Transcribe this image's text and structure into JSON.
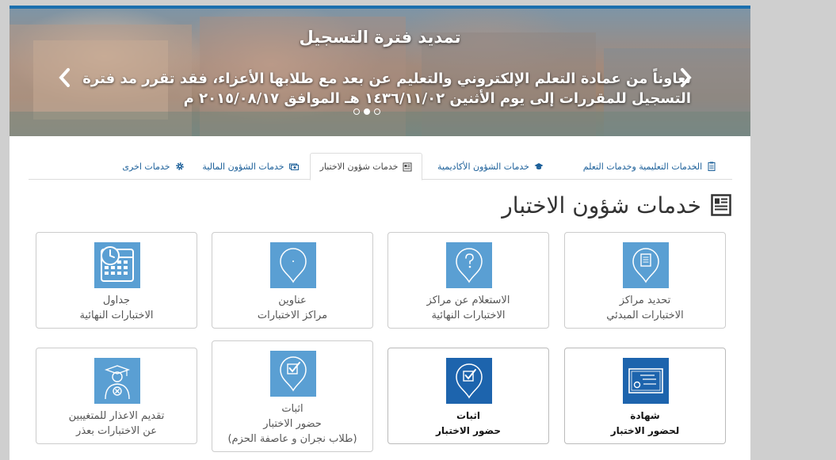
{
  "slider": {
    "title": "تمديد فترة التسجيل",
    "text": "تعاوناً من عمادة التعلم الإلكتروني والتعليم عن بعد مع طلابها الأعزاء، فقد تقرر مد فترة التسجيل للمقررات إلى يوم الأثنين ١٤٣٦/١١/٠٢ هـ الموافق ٢٠١٥/٠٨/١٧ م",
    "active_dot": 2
  },
  "tabs": [
    {
      "label": "الخدمات التعليمية وخدمات التعلم",
      "icon": "clipboard-icon",
      "active": false
    },
    {
      "label": "خدمات الشؤون الأكاديمية",
      "icon": "graduation-cap-icon",
      "active": false
    },
    {
      "label": "خدمات شؤون الاختبار",
      "icon": "newspaper-icon",
      "active": true
    },
    {
      "label": "خدمات الشؤون المالية",
      "icon": "money-icon",
      "active": false
    },
    {
      "label": "خدمات اخرى",
      "icon": "gear-icon",
      "active": false
    }
  ],
  "section_title": "خدمات شؤون الاختبار",
  "colors": {
    "accent": "#1b6fae",
    "icon_light": "#5a9fd3",
    "icon_dark": "#1d64ad"
  },
  "cards": [
    {
      "line1": "تحديد مراكز",
      "line2": "الاختبارات المبدئي",
      "line3": "",
      "icon": "document-pin-icon"
    },
    {
      "line1": "الاستعلام عن مراكز",
      "line2": "الاختبارات النهائية",
      "line3": "",
      "icon": "question-pin-icon"
    },
    {
      "line1": "عناوين",
      "line2": "مراكز الاختبارات",
      "line3": "",
      "icon": "location-pin-icon"
    },
    {
      "line1": "جداول",
      "line2": "الاختبارات النهائية",
      "line3": "",
      "icon": "calendar-clock-icon"
    },
    {
      "line1": "شهادة",
      "line2": "لحضور الاختبار",
      "line3": "",
      "icon": "certificate-icon"
    },
    {
      "line1": "اثبات",
      "line2": "حضور الاختبار",
      "line3": "",
      "icon": "check-pin-icon"
    },
    {
      "line1": "اثبات",
      "line2": "حضور الاختبار",
      "line3": "(طلاب نجران و عاصفة الحزم)",
      "icon": "check-pin-icon"
    },
    {
      "line1": "تقديم الاعذار للمتغيبين",
      "line2": "عن الاختبارات بعذر",
      "line3": "",
      "icon": "student-excuse-icon"
    }
  ]
}
